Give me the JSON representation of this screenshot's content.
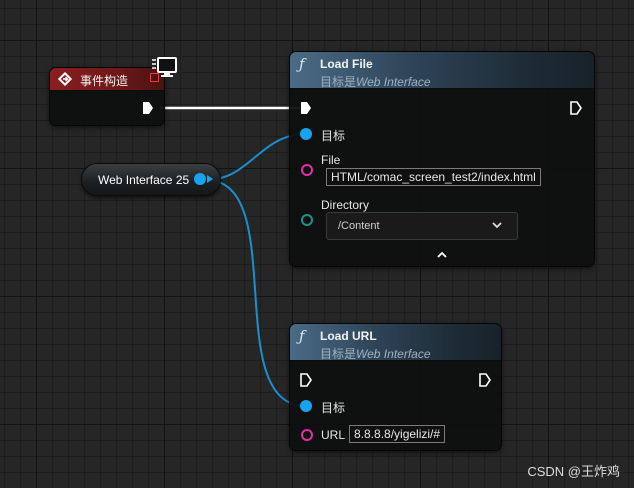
{
  "colors": {
    "exec": "#ffffff",
    "object_pin": "#17a3f0",
    "string_pin": "#e02fa8",
    "name_pin": "#1e8f8a",
    "event_header": "#7a1c1c",
    "function_header": "#3a5670"
  },
  "event_node": {
    "title": "事件构造",
    "icon": "event-diamond-icon",
    "badge_icon": "monitor-server-icon"
  },
  "variable_node": {
    "label": "Web Interface 25"
  },
  "load_file": {
    "title": "Load File",
    "subtitle_prefix": "目标是",
    "subtitle_target": "Web Interface",
    "target_label": "目标",
    "file_label": "File",
    "file_value": "HTML/comac_screen_test2/index.html",
    "directory_label": "Directory",
    "directory_value": "/Content",
    "collapse_icon": "chevron-up-icon"
  },
  "load_url": {
    "title": "Load URL",
    "subtitle_prefix": "目标是",
    "subtitle_target": "Web Interface",
    "target_label": "目标",
    "url_label": "URL",
    "url_value": "8.8.8.8/yigelizi/#"
  },
  "watermark": "CSDN @王炸鸡"
}
